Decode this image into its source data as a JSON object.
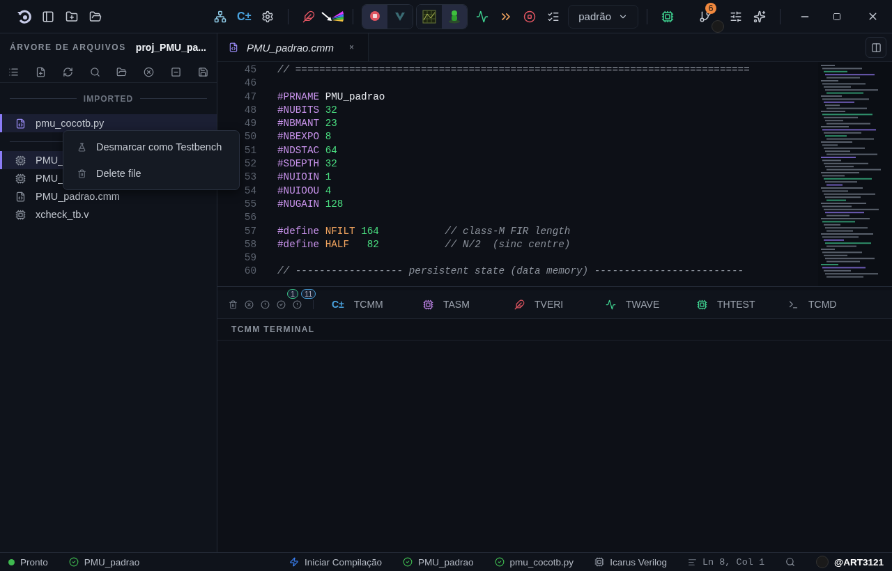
{
  "toolbar": {
    "cmm_icon": "C±",
    "profile": "padrão",
    "git_badge": "6",
    "toggle_groups": [
      {
        "buttons": [
          {
            "selected": true
          },
          {
            "selected": false
          }
        ]
      },
      {
        "buttons": [
          {
            "selected": false
          },
          {
            "selected": true
          }
        ]
      }
    ]
  },
  "sidebar": {
    "title": "ÁRVORE DE ARQUIVOS",
    "project": "proj_PMU_pa...",
    "sections": [
      {
        "heading": "IMPORTED",
        "items": [
          {
            "name": "pmu_cocotb.py",
            "kind": "python",
            "selected": true
          }
        ]
      },
      {
        "items": [
          {
            "name": "PMU_",
            "kind": "chip",
            "selected": true
          },
          {
            "name": "PMU_",
            "kind": "chip",
            "selected": false
          },
          {
            "name": "PMU_padrao.cmm",
            "kind": "cmm",
            "selected": false
          },
          {
            "name": "xcheck_tb.v",
            "kind": "chip",
            "selected": false
          }
        ]
      }
    ]
  },
  "context_menu": {
    "items": [
      {
        "label": "Desmarcar como Testbench",
        "kind": "flask"
      },
      {
        "label": "Delete file",
        "kind": "trash"
      }
    ]
  },
  "editor": {
    "tab": {
      "label": "PMU_padrao.cmm",
      "close": "×"
    },
    "lines": [
      {
        "number": "45",
        "tokens": [
          {
            "kind": "comment",
            "text": "// ============================================================================"
          }
        ]
      },
      {
        "number": "46"
      },
      {
        "number": "47",
        "tokens": [
          {
            "kind": "directive",
            "text": "#PRNAME"
          },
          {
            "kind": "plain",
            "text": " PMU_padrao"
          }
        ]
      },
      {
        "number": "48",
        "tokens": [
          {
            "kind": "directive",
            "text": "#NUBITS"
          },
          {
            "kind": "number",
            "text": " 32"
          }
        ]
      },
      {
        "number": "49",
        "tokens": [
          {
            "kind": "directive",
            "text": "#NBMANT"
          },
          {
            "kind": "number",
            "text": " 23"
          }
        ]
      },
      {
        "number": "50",
        "tokens": [
          {
            "kind": "directive",
            "text": "#NBEXPO"
          },
          {
            "kind": "number",
            "text": " 8"
          }
        ]
      },
      {
        "number": "51",
        "tokens": [
          {
            "kind": "directive",
            "text": "#NDSTAC"
          },
          {
            "kind": "number",
            "text": " 64"
          }
        ]
      },
      {
        "number": "52",
        "tokens": [
          {
            "kind": "directive",
            "text": "#SDEPTH"
          },
          {
            "kind": "number",
            "text": " 32"
          }
        ]
      },
      {
        "number": "53",
        "tokens": [
          {
            "kind": "directive",
            "text": "#NUIOIN"
          },
          {
            "kind": "number",
            "text": " 1"
          }
        ]
      },
      {
        "number": "54",
        "tokens": [
          {
            "kind": "directive",
            "text": "#NUIOOU"
          },
          {
            "kind": "number",
            "text": " 4"
          }
        ]
      },
      {
        "number": "55",
        "tokens": [
          {
            "kind": "directive",
            "text": "#NUGAIN"
          },
          {
            "kind": "number",
            "text": " 128"
          }
        ]
      },
      {
        "number": "56"
      },
      {
        "number": "57",
        "tokens": [
          {
            "kind": "directive",
            "text": "#define"
          },
          {
            "kind": "macro",
            "text": " NFILT"
          },
          {
            "kind": "number",
            "text": " 164"
          },
          {
            "kind": "comment",
            "text": "           // class-M FIR length"
          }
        ]
      },
      {
        "number": "58",
        "tokens": [
          {
            "kind": "directive",
            "text": "#define"
          },
          {
            "kind": "macro",
            "text": " HALF"
          },
          {
            "kind": "number",
            "text": "   82"
          },
          {
            "kind": "comment",
            "text": "           // N/2  (sinc centre)"
          }
        ]
      },
      {
        "number": "59"
      },
      {
        "number": "60",
        "tokens": [
          {
            "kind": "comment",
            "text": "// ------------------ persistent state (data memory) -------------------------"
          }
        ]
      }
    ]
  },
  "panel": {
    "badges": [
      "1",
      "11"
    ],
    "tabs": [
      {
        "label": "TCMM",
        "icon_text": "C±"
      },
      {
        "label": "TASM",
        "kind": "asm"
      },
      {
        "label": "TVERI",
        "kind": "veri"
      },
      {
        "label": "TWAVE",
        "kind": "wave"
      },
      {
        "label": "THTEST",
        "kind": "htest"
      },
      {
        "label": "TCMD",
        "kind": "cmd"
      }
    ],
    "terminal_title": "TCMM TERMINAL"
  },
  "status_bar": {
    "left": [
      {
        "label": "Pronto",
        "kind": "dot"
      },
      {
        "label": "PMU_padrao",
        "kind": "check"
      }
    ],
    "right": [
      {
        "label": "Iniciar Compilação",
        "kind": "zap"
      },
      {
        "label": "PMU_padrao",
        "kind": "check"
      },
      {
        "label": "pmu_cocotb.py",
        "kind": "check"
      },
      {
        "label": "Icarus Verilog",
        "kind": "chip"
      },
      {
        "label": "Ln 8, Col 1",
        "kind": "lines"
      },
      {
        "kind": "search"
      }
    ],
    "user": "@ART3121"
  }
}
